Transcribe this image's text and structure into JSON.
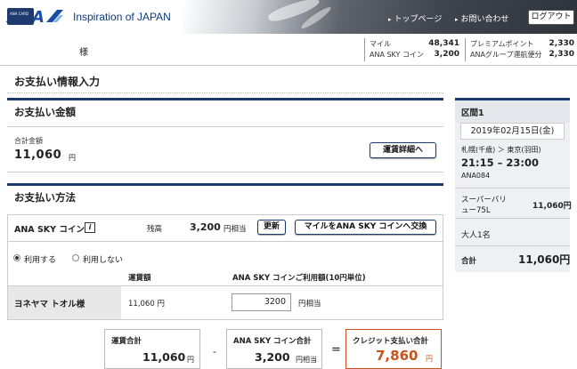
{
  "header": {
    "brand": "ANA",
    "tagline": "Inspiration of JAPAN",
    "nav_top": "トップページ",
    "nav_contact": "お問い合わせ",
    "logout": "ログアウト"
  },
  "member": {
    "card_text": "ANA CARD",
    "honorific": "様",
    "miles_label": "マイル",
    "miles_value": "48,341",
    "skycoin_label": "ANA SKY コイン",
    "skycoin_value": "3,200",
    "premium_label": "プレミアムポイント",
    "premium_value": "2,330",
    "group_label": "ANAグループ運航便分",
    "group_value": "2,330"
  },
  "page": {
    "title": "お支払い情報入力"
  },
  "amount_section": {
    "heading": "お支払い金額",
    "total_label": "合計金額",
    "total_value": "11,060",
    "yen": "円",
    "fare_detail_button": "運賃詳細へ"
  },
  "method_section": {
    "heading": "お支払い方法",
    "coin_label": "ANA SKY コイン",
    "info_glyph": "i",
    "balance_label": "残高",
    "balance_value": "3,200",
    "balance_unit": "円相当",
    "refresh_button": "更新",
    "exchange_button": "マイルをANA SKY コインへ交換",
    "radio_use": "利用する",
    "radio_nouse": "利用しない",
    "col_fare": "運賃額",
    "col_coin_use": "ANA SKY コインご利用額(10円単位)",
    "passenger_name": "ヨネヤマ トオル様",
    "fare_value": "11,060 円",
    "coin_input_value": "3200",
    "coin_input_unit": "円相当"
  },
  "totals": {
    "fare_total_label": "運賃合計",
    "fare_total_value": "11,060",
    "fare_total_unit": "円",
    "minus": "-",
    "coin_total_label": "ANA SKY コイン合計",
    "coin_total_value": "3,200",
    "coin_total_unit": "円相当",
    "equals": "=",
    "credit_total_label": "クレジット支払い合計",
    "credit_total_value": "7,860",
    "credit_total_unit": "円"
  },
  "flight": {
    "section": "区間1",
    "date": "2019年02月15日(金)",
    "route": "札幌(千歳) ＞ 東京(羽田)",
    "time": "21:15 – 23:00",
    "flight_no": "ANA084",
    "fare_type_1": "スーパーバリ",
    "fare_type_2": "ュー75L",
    "fare_price": "11,060円",
    "pax": "大人1名",
    "total_label": "合計",
    "total_value": "11,060円"
  },
  "colors": {
    "brand_navy": "#1b3a6e",
    "accent_orange": "#c8521a",
    "ana_blue": "#1b4ea3"
  }
}
